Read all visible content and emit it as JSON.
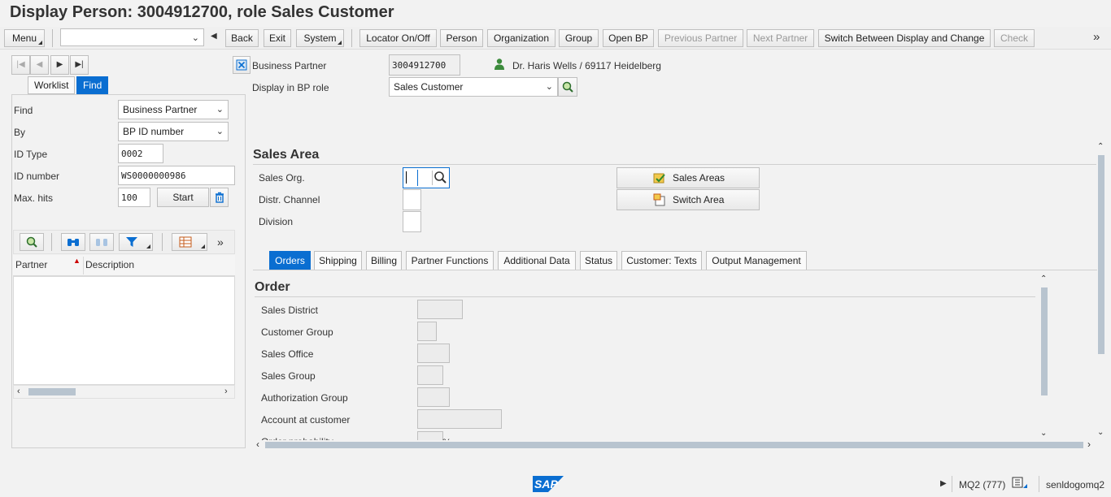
{
  "window": {
    "title": "Display Person: 3004912700, role Sales Customer"
  },
  "toolbar": {
    "menu": "Menu",
    "command_value": "",
    "back": "Back",
    "exit": "Exit",
    "system": "System",
    "locator": "Locator On/Off",
    "person": "Person",
    "organization": "Organization",
    "group": "Group",
    "open_bp": "Open BP",
    "previous_partner": "Previous Partner",
    "next_partner": "Next Partner",
    "switch": "Switch Between Display and Change",
    "check": "Check",
    "more": "»"
  },
  "locator": {
    "tabs": {
      "worklist": "Worklist",
      "find": "Find"
    },
    "find_label": "Find",
    "find_value": "Business Partner",
    "by_label": "By",
    "by_value": "BP ID number",
    "id_type_label": "ID Type",
    "id_type_value": "0002",
    "id_number_label": "ID number",
    "id_number_value": "WS0000000986",
    "max_hits_label": "Max. hits",
    "max_hits_value": "100",
    "start": "Start",
    "columns": {
      "partner": "Partner",
      "description": "Description"
    },
    "more": "»"
  },
  "header": {
    "bp_label": "Business Partner",
    "bp_value": "3004912700",
    "bp_desc": "Dr. Haris Wells / 69117 Heidelberg",
    "role_label": "Display in BP role",
    "role_value": "Sales Customer"
  },
  "sales_area": {
    "title": "Sales Area",
    "sales_org_label": "Sales Org.",
    "distr_channel_label": "Distr. Channel",
    "division_label": "Division",
    "sales_areas_btn": "Sales Areas",
    "switch_area_btn": "Switch Area"
  },
  "tabs": [
    "Orders",
    "Shipping",
    "Billing",
    "Partner Functions",
    "Additional Data",
    "Status",
    "Customer: Texts",
    "Output Management"
  ],
  "order": {
    "title": "Order",
    "fields": [
      "Sales District",
      "Customer Group",
      "Sales Office",
      "Sales Group",
      "Authorization Group",
      "Account at customer",
      "Order probability"
    ],
    "percent": "%"
  },
  "footer": {
    "system": "MQ2 (777)",
    "host": "senldogomq2",
    "logo": "SAP"
  },
  "colors": {
    "accent": "#0a6ed1",
    "sap_logo": "#0a6ed1"
  }
}
